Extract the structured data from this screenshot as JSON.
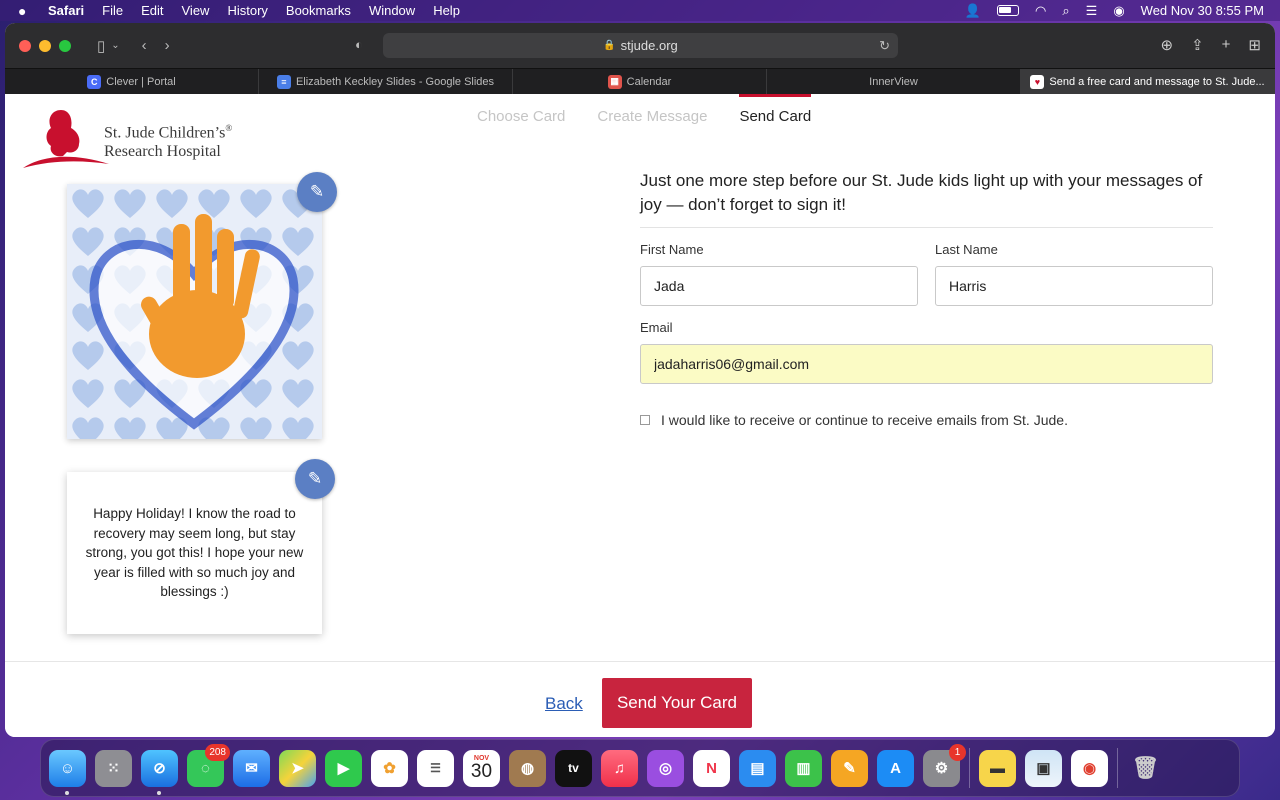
{
  "menubar": {
    "app": "Safari",
    "items": [
      "File",
      "Edit",
      "View",
      "History",
      "Bookmarks",
      "Window",
      "Help"
    ],
    "datetime": "Wed Nov 30  8:55 PM"
  },
  "browser": {
    "url": "stjude.org",
    "tabs": [
      {
        "label": "Clever | Portal",
        "color": "#4a6cf7",
        "glyph": "C"
      },
      {
        "label": "Elizabeth Keckley Slides - Google Slides",
        "color": "#4a7ee8",
        "glyph": "≡"
      },
      {
        "label": "Calendar",
        "color": "#e0544c",
        "glyph": "▦"
      },
      {
        "label": "InnerView",
        "color": "",
        "glyph": ""
      },
      {
        "label": "Send a free card and message to St. Jude...",
        "color": "#c8102e",
        "glyph": "♥"
      }
    ]
  },
  "logo": {
    "line1": "St. Jude Children’s",
    "line2": "Research Hospital",
    "reg": "®"
  },
  "steps": [
    "Choose Card",
    "Create Message",
    "Send Card"
  ],
  "card": {
    "message": "Happy Holiday! I know the road to recovery may seem long, but stay strong, you got this! I hope your new year is filled with so much joy and blessings :)"
  },
  "form": {
    "heading": "Just one more step before our St. Jude kids light up with your messages of joy — don’t forget to sign it!",
    "first_name_label": "First Name",
    "first_name_value": "Jada",
    "last_name_label": "Last Name",
    "last_name_value": "Harris",
    "email_label": "Email",
    "email_value": "jadaharris06@gmail.com",
    "optin_label": "I would like to receive or continue to receive emails from St. Jude."
  },
  "actions": {
    "back_label": "Back",
    "send_label": "Send Your Card"
  },
  "dock": {
    "messages_badge": "208",
    "calendar_month": "NOV",
    "calendar_day": "30",
    "settings_badge": "1",
    "tv_label": "tv"
  },
  "colors": {
    "brand_red": "#c8102e",
    "edit_blue": "#5b7fc4",
    "autofill_yellow": "#fbfbc5"
  }
}
